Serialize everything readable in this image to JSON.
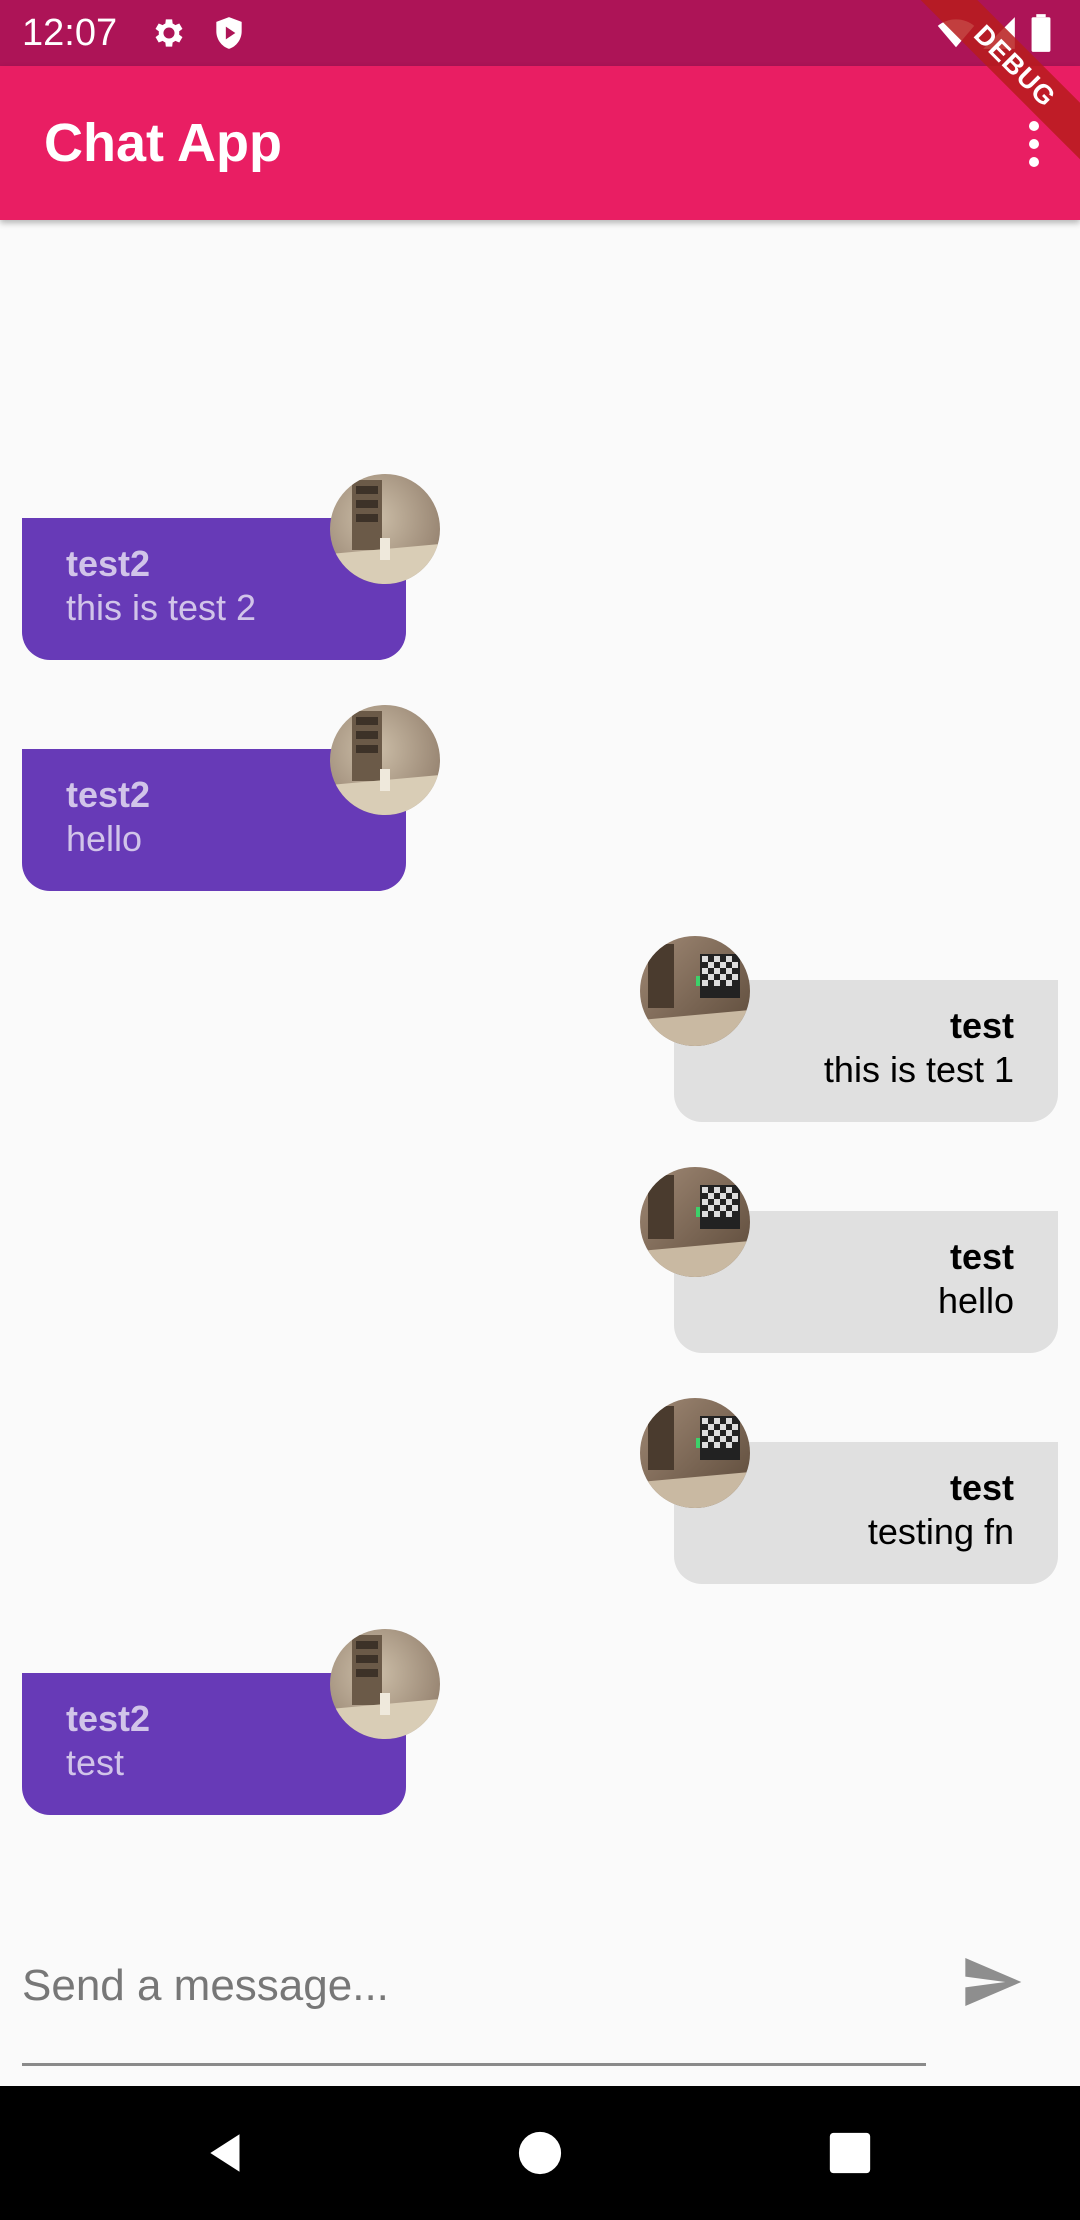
{
  "status_bar": {
    "time": "12:07"
  },
  "app_bar": {
    "title": "Chat App",
    "debug_label": "DEBUG"
  },
  "messages": [
    {
      "user": "test2",
      "text": "this is test 2",
      "side": "left"
    },
    {
      "user": "test2",
      "text": "hello",
      "side": "left"
    },
    {
      "user": "test",
      "text": "this is test 1",
      "side": "right"
    },
    {
      "user": "test",
      "text": "hello",
      "side": "right"
    },
    {
      "user": "test",
      "text": "testing fn",
      "side": "right"
    },
    {
      "user": "test2",
      "text": "test",
      "side": "left"
    }
  ],
  "composer": {
    "placeholder": "Send a message...",
    "value": ""
  },
  "colors": {
    "status_bar": "#ad1457",
    "app_bar": "#e91e63",
    "left_bubble": "#673ab7",
    "left_text": "#d1c4e9",
    "right_bubble": "#e0e0e0",
    "background": "#fafafa"
  }
}
